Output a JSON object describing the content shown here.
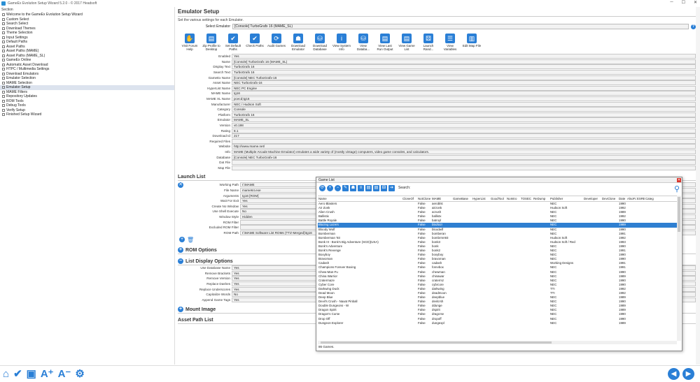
{
  "window": {
    "title": "GameEx Evolution Setup Wizard 5.2.0 - © 2017 Headsoft",
    "minimize": "─",
    "maximize": "☐",
    "close": "✕"
  },
  "sidebar": {
    "section_label": "Section",
    "items": [
      {
        "label": "Welcome to the GameEx Evolution Setup Wizard"
      },
      {
        "label": "Custom Select"
      },
      {
        "label": "Search Select"
      },
      {
        "label": "Download Themes"
      },
      {
        "label": "Theme Selection"
      },
      {
        "label": "Input Settings"
      },
      {
        "label": "Default Paths"
      },
      {
        "label": "Asset Paths"
      },
      {
        "label": "Asset Paths (MAME)"
      },
      {
        "label": "Asset Paths (MAME_SL)"
      },
      {
        "label": "GameEx Online"
      },
      {
        "label": "Automatic Asset Download"
      },
      {
        "label": "HTPC / Multimedia Settings"
      },
      {
        "label": "Download Emulators"
      },
      {
        "label": "Emulator Selection"
      },
      {
        "label": "MAME Selection"
      },
      {
        "label": "Emulator Setup",
        "selected": true
      },
      {
        "label": "MAME Filters"
      },
      {
        "label": "Repository Updates"
      },
      {
        "label": "ROM Tools"
      },
      {
        "label": "Debug Tools"
      },
      {
        "label": "Verify Setup"
      },
      {
        "label": "Finished Setup Wizard"
      }
    ]
  },
  "main": {
    "title": "Emulator Setup",
    "subtitle": "Set the various settings for each Emulator.",
    "select_label": "Select Emulator",
    "select_value": "[Console] TurboGrafx 16 (MAME_SL)",
    "toolbar": [
      {
        "label": "Visit Forum Help",
        "icon": "forum-icon",
        "glyph": "✋"
      },
      {
        "label": "Zip Profile to Desktop",
        "icon": "zip-icon",
        "glyph": "▤"
      },
      {
        "label": "Set Default Paths",
        "icon": "paths-icon",
        "glyph": "✔"
      },
      {
        "label": "Check Paths",
        "icon": "check-icon",
        "glyph": "✔"
      },
      {
        "label": "Audit Games",
        "icon": "audit-icon",
        "glyph": "⟳"
      },
      {
        "label": "Download Emulator",
        "icon": "invader-icon",
        "glyph": "☗"
      },
      {
        "label": "Download Database",
        "icon": "database-icon",
        "glyph": "⛁"
      },
      {
        "label": "View System Info",
        "icon": "info-icon",
        "glyph": "i"
      },
      {
        "label": "View Databa...",
        "icon": "view-database-icon",
        "glyph": "⛁"
      },
      {
        "label": "View Last Run Output",
        "icon": "document-icon",
        "glyph": "▤"
      },
      {
        "label": "View Game List",
        "icon": "gamelist-icon",
        "glyph": "▤"
      },
      {
        "label": "Launch Rand...",
        "icon": "dice-icon",
        "glyph": "⚄"
      },
      {
        "label": "View Variables",
        "icon": "variables-icon",
        "glyph": "☰"
      },
      {
        "label": "Edit Map File",
        "icon": "map-icon",
        "glyph": "▥"
      }
    ],
    "fields": [
      {
        "label": "Enabled",
        "value": "Yes"
      },
      {
        "label": "Name",
        "value": "[Console] TurboGrafx 16 (MAME_SL)"
      },
      {
        "label": "Display Text",
        "value": "TurboGrafx 16"
      },
      {
        "label": "Search Text",
        "value": "TurboGrafx 16"
      },
      {
        "label": "GameEx Name",
        "value": "[Console] NEC TurboGrafx-16"
      },
      {
        "label": "Asset Name",
        "value": "NEC TurboGrafx-16"
      },
      {
        "label": "HyperList Name",
        "value": "NEC PC Engine"
      },
      {
        "label": "MAME Name",
        "value": "tg16"
      },
      {
        "label": "MAME XL Name",
        "value": "pcecd;tg16"
      },
      {
        "label": "Manufacturer",
        "value": "NEC / Hudson Soft"
      },
      {
        "label": "Category",
        "value": "Console"
      },
      {
        "label": "Platform",
        "value": "TurboGrafx 16"
      },
      {
        "label": "Emulator",
        "value": "MAME_SL"
      },
      {
        "label": "Version",
        "value": "v0.198"
      },
      {
        "label": "Rating",
        "value": "8.1"
      },
      {
        "label": "Download Id",
        "value": "217"
      },
      {
        "label": "Required Files",
        "value": ""
      },
      {
        "label": "Website",
        "value": "http://www.mame.net/"
      },
      {
        "label": "Info",
        "value": "MAME (Multiple Arcade Machine Emulator) emulates a wide variety of (mostly vintage) computers, video game consoles, and calculators."
      },
      {
        "label": "Database",
        "value": "[Console] NEC TurboGrafx-16"
      },
      {
        "label": "Dat File",
        "value": ""
      },
      {
        "label": "Map File",
        "value": ""
      }
    ],
    "launch_title": "Launch List",
    "launch_fields": [
      {
        "label": "Working Path",
        "value": "I:\\MAME"
      },
      {
        "label": "File Name",
        "value": "mame64.exe"
      },
      {
        "label": "Arguments",
        "value": "tg16 [ROM]"
      },
      {
        "label": "Wait For Exit",
        "value": "Yes"
      },
      {
        "label": "Create No Window",
        "value": "Yes"
      },
      {
        "label": "Use Shell Execute",
        "value": "No"
      },
      {
        "label": "Window Style",
        "value": "Hidden"
      },
      {
        "label": "ROM Filter",
        "value": ""
      },
      {
        "label": "Excluded ROM Filter",
        "value": ""
      },
      {
        "label": "ROM Path",
        "value": "I:\\MAME Software List ROMs (TTZ-Merged)\\tg16"
      }
    ],
    "rom_options_title": "ROM Options",
    "list_display_title": "List Display Options",
    "list_display_fields": [
      {
        "label": "Use Database Name",
        "value": "Yes"
      },
      {
        "label": "Remove Brackets",
        "value": "Yes"
      },
      {
        "label": "Remove Version",
        "value": "Yes"
      },
      {
        "label": "Replace Dashes",
        "value": "Yes"
      },
      {
        "label": "Replace Underscores",
        "value": "Yes"
      },
      {
        "label": "Capitalize Words",
        "value": "No"
      },
      {
        "label": "Append Game Tags",
        "value": "Yes"
      }
    ],
    "mount_image_title": "Mount Image",
    "asset_path_title": "Asset Path List"
  },
  "gamelist": {
    "title": "Game List",
    "search_label": "Search:",
    "columns": [
      "Name",
      "CloneOf",
      "NotClone",
      "MAME",
      "GameBase",
      "HyperList",
      "GoodTool",
      "NoIntro",
      "TOSEC",
      "ReDump",
      "Publisher",
      "Developer",
      "DevClone",
      "Date",
      "AlsoFor",
      "ESRB",
      "Categ"
    ],
    "rows": [
      [
        "Aero Blasters",
        "",
        "False",
        "aeroblst",
        "",
        "",
        "",
        "",
        "",
        "",
        "NEC",
        "",
        "",
        "1990"
      ],
      [
        "Air Zonk",
        "",
        "False",
        "airzonk",
        "",
        "",
        "",
        "",
        "",
        "",
        "Hudson Soft",
        "",
        "",
        "1992"
      ],
      [
        "Alien Crush",
        "",
        "False",
        "acrush",
        "",
        "",
        "",
        "",
        "",
        "",
        "NEC",
        "",
        "",
        "1989"
      ],
      [
        "Ballistix",
        "",
        "False",
        "ballistx",
        "",
        "",
        "",
        "",
        "",
        "",
        "NEC",
        "",
        "",
        "1992"
      ],
      [
        "Battle Royale",
        "",
        "False",
        "batroyl",
        "",
        "",
        "",
        "",
        "",
        "",
        "NEC",
        "",
        "",
        "1990"
      ],
      [
        "Blazing Lazers",
        "",
        "False",
        "blazlazr",
        "",
        "",
        "",
        "",
        "",
        "",
        "NEC",
        "",
        "",
        "1989"
      ],
      [
        "Bloody Wolf",
        "",
        "False",
        "bloodwlf",
        "",
        "",
        "",
        "",
        "",
        "",
        "NEC",
        "",
        "",
        "1990"
      ],
      [
        "Bomberman",
        "",
        "False",
        "bomberan",
        "",
        "",
        "",
        "",
        "",
        "",
        "NEC",
        "",
        "",
        "1991"
      ],
      [
        "Bomberman '93",
        "",
        "False",
        "bombrmn93",
        "",
        "",
        "",
        "",
        "",
        "",
        "Hudson Soft",
        "",
        "",
        "1992"
      ],
      [
        "Bonk III - Bonk's Big Adventure (SCD)(USA)",
        "",
        "False",
        "bonk3",
        "",
        "",
        "",
        "",
        "",
        "",
        "Hudson Soft / Red",
        "",
        "",
        "1993"
      ],
      [
        "Bonk's Adventure",
        "",
        "False",
        "bonk",
        "",
        "",
        "",
        "",
        "",
        "",
        "NEC",
        "",
        "",
        "1990"
      ],
      [
        "Bonk's Revenge",
        "",
        "False",
        "bonk2",
        "",
        "",
        "",
        "",
        "",
        "",
        "NEC",
        "",
        "",
        "1991"
      ],
      [
        "Boxyboy",
        "",
        "False",
        "boxyboy",
        "",
        "",
        "",
        "",
        "",
        "",
        "NEC",
        "",
        "",
        "1990"
      ],
      [
        "Bravoman",
        "",
        "False",
        "bravoman",
        "",
        "",
        "",
        "",
        "",
        "",
        "NEC",
        "",
        "",
        "1990"
      ],
      [
        "Cadash",
        "",
        "False",
        "cadash",
        "",
        "",
        "",
        "",
        "",
        "",
        "Working Designs",
        "",
        "",
        "1991"
      ],
      [
        "Champions Forever Boxing",
        "",
        "False",
        "forevbox",
        "",
        "",
        "",
        "",
        "",
        "",
        "NEC",
        "",
        "",
        "1991"
      ],
      [
        "Chew-Man-Fu",
        "",
        "False",
        "chewman",
        "",
        "",
        "",
        "",
        "",
        "",
        "NEC",
        "",
        "",
        "1990"
      ],
      [
        "China Warrior",
        "",
        "False",
        "chinawar",
        "",
        "",
        "",
        "",
        "",
        "",
        "NEC",
        "",
        "",
        "1989"
      ],
      [
        "Cratermaze",
        "",
        "False",
        "cratermz",
        "",
        "",
        "",
        "",
        "",
        "",
        "NEC",
        "",
        "",
        "1990"
      ],
      [
        "Cyber Core",
        "",
        "False",
        "cybrcore",
        "",
        "",
        "",
        "",
        "",
        "",
        "NEC",
        "",
        "",
        "1990"
      ],
      [
        "Darkwing Duck",
        "",
        "False",
        "darkwing",
        "",
        "",
        "",
        "",
        "",
        "",
        "TTI",
        "",
        "",
        "1992"
      ],
      [
        "Dead Moon",
        "",
        "False",
        "deadmoon",
        "",
        "",
        "",
        "",
        "",
        "",
        "TTI",
        "",
        "",
        "1992"
      ],
      [
        "Deep Blue",
        "",
        "False",
        "deepblue",
        "",
        "",
        "",
        "",
        "",
        "",
        "NEC",
        "",
        "",
        "1989"
      ],
      [
        "Devil's Crush - Naxat Pinball",
        "",
        "False",
        "devlcrsh",
        "",
        "",
        "",
        "",
        "",
        "",
        "NEC",
        "",
        "",
        "1990"
      ],
      [
        "Double Dungeons - W",
        "",
        "False",
        "ddunge",
        "",
        "",
        "",
        "",
        "",
        "",
        "NEC",
        "",
        "",
        "1989"
      ],
      [
        "Dragon Spirit",
        "",
        "False",
        "dspirit",
        "",
        "",
        "",
        "",
        "",
        "",
        "NEC",
        "",
        "",
        "1989"
      ],
      [
        "Dragon's Curse",
        "",
        "False",
        "dragcrse",
        "",
        "",
        "",
        "",
        "",
        "",
        "NEC",
        "",
        "",
        "1990"
      ],
      [
        "Drop Off",
        "",
        "False",
        "dropoff",
        "",
        "",
        "",
        "",
        "",
        "",
        "NEC",
        "",
        "",
        "1990"
      ],
      [
        "Dungeon Explorer",
        "",
        "False",
        "dungexpl",
        "",
        "",
        "",
        "",
        "",
        "",
        "NEC",
        "",
        "",
        "1989"
      ]
    ],
    "selected_index": 5,
    "status": "86 Games."
  }
}
